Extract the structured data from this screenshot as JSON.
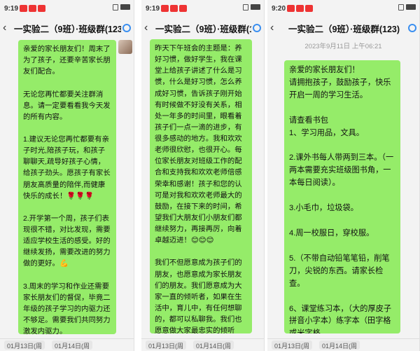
{
  "panels": [
    {
      "time": "9:19",
      "title": "一实验二（9班）·班级群(123)",
      "message": "亲爱的家长朋友们！周末了为了孩子，还要辛苦家长朋友们配合。\n\n无论您再忙都要关注群消息。请一定要看看我今天发的所有内容。\n\n1.建议无论您再忙都要有亲子时光,陪孩子玩，和孩子聊聊天,疏导好孩子心情，给孩子劲头。愿孩子有家长朋友高质量的陪伴,而健康快乐的成长！🌹🌹🌹\n\n2.开学第一个周，孩子们表现很不错，对比发现，需要适应学校生活的感受。好的继续发扬，需要改进的努力做的更好。💪\n\n3.周末的学习和作业还需要家长朋友们的督促，毕竟二年级的孩子学习的内驱力还不够足。需要我们共同努力激发内驱力。\n\n3、良好的生活习惯和学习习惯让孩子终身收益。我们的孩子是养成好习惯的最关键时期，需要我们一起督促。\n昨天下午班会的主题是：养好习惯，做好学生，我在课堂上给孩子讲述了什么",
      "tabs": [
        "01月13日(周",
        "01月14日(周"
      ]
    },
    {
      "time": "9:19",
      "title": "一实验二（9班）·班级群(123)",
      "message": "昨天下午班会的主题是：养好习惯，做好学生，我在课堂上给孩子讲述了什么是习惯，什么是好习惯，怎么养成好习惯，告诉孩子刚开始有时候做不好没有关系，相处一年多的时间里，眼看着孩子们一点一滴的进步，有很多感动的地方。我和欢欢老师很欣慰，也很开心。每位家长朋友对班级工作的配合和支持我和欢欢老师倍感荣幸和感谢！孩子和您的认可是对我和欢欢老师最大的鼓励，在接下来的时间，希望我们大朋友们小朋友们都继续努力，再接再厉，向着卓越迈进！😊😊😊\n\n我们不但愿意成为孩子们的朋友，也愿意成为家长朋友们的朋友。我们愿意成为大家一直的倾听者，如果在生活中，育儿中，有任何想聊的，都可以私聊我。我们也愿意做大家最忠实的倾听者。\n\n我们扮演着不同的角色，我们担着不同的责任，生活给了我们不同的考验和压力，但也让我们有了不同的收获和成长，共同的目标，共同希望和前进的动力。希望我们都能疏导好自己的情绪，温和的看待身边的人和事",
      "tabs": [
        "01月13日(周",
        "01月14日(周"
      ]
    },
    {
      "time": "9:20",
      "title": "一实验二（9班）·班级群(123)",
      "timestamp": "2023年9月11日 上午06:21",
      "message": "亲爱的家长朋友们！\n请拥抱孩子，鼓励孩子，快乐开启一周的学习生活。\n\n请查看书包\n1、学习用品，文具。\n\n2.课外书每人带两到三本。（一两本需要充实班级图书角，一本每日阅读）。\n\n3.小毛巾，垃圾袋。\n\n4.周一校服日，穿校服。\n\n5.（不带自动铅笔笔铅，削笔刀，尖锐的东西。请家长检查。\n\n6、课堂练习本，（大的厚皮子拼音小字本）练字本（田字格或米字格\n\n7.一定送到接送点，三人成对不奔跑。见到老师要问好。入班即读！\n\n努力做更好的自己！😊😊😊@所有人",
      "tabs": [
        "01月13日(周",
        "01月14日(周"
      ]
    }
  ]
}
